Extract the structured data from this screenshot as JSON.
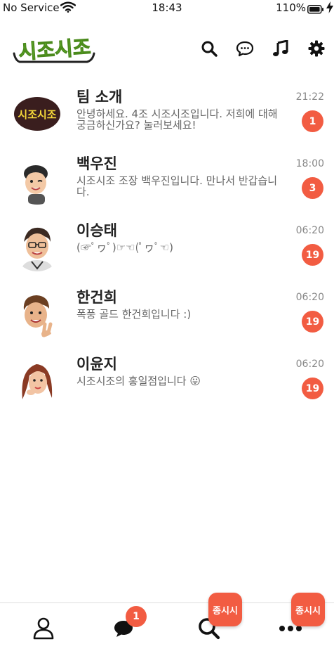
{
  "status_bar": {
    "carrier": "No Service",
    "time": "18:43",
    "battery": "110%"
  },
  "header": {
    "logo_text": "시조시조",
    "icons": [
      "search-icon",
      "chat-bubble-icon",
      "music-note-icon",
      "gear-icon"
    ]
  },
  "chats": [
    {
      "name": "팀 소개",
      "preview": "안녕하세요. 4조 시조시조입니다. 저희에 대해 궁금하신가요? 눌러보세요!",
      "time": "21:22",
      "unread": "1",
      "avatar_text": "시조시조"
    },
    {
      "name": "백우진",
      "preview": "시조시조 조장 백우진입니다. 만나서 반갑습니다.",
      "time": "18:00",
      "unread": "3"
    },
    {
      "name": "이승태",
      "preview": "(☞ﾟヮﾟ)☞☜(ﾟヮﾟ☜)",
      "time": "06:20",
      "unread": "19"
    },
    {
      "name": "한건희",
      "preview": "폭풍 골드 한건희입니다 :)",
      "time": "06:20",
      "unread": "19"
    },
    {
      "name": "이윤지",
      "preview": "시조시조의 홍일점입니다 😛",
      "time": "06:20",
      "unread": "19"
    }
  ],
  "tab_bar": {
    "tabs": [
      "person-icon",
      "chat-bubbles-icon",
      "search-icon",
      "more-icon"
    ],
    "chats_badge": "1",
    "fab_labels": [
      "종시시",
      "종시시"
    ]
  },
  "colors": {
    "accent": "#f25c42",
    "logo_green": "#7bd33b",
    "logo_dark": "#3a1e1e",
    "logo_yellow": "#f6d93a"
  }
}
